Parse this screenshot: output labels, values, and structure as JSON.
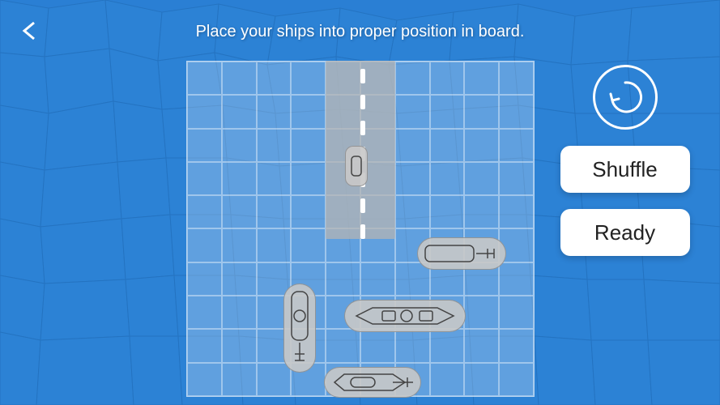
{
  "title": "Place your ships into proper position in board.",
  "back_button": "‹",
  "buttons": {
    "shuffle_label": "Shuffle",
    "ready_label": "Ready"
  },
  "board": {
    "cols": 10,
    "rows": 10
  }
}
